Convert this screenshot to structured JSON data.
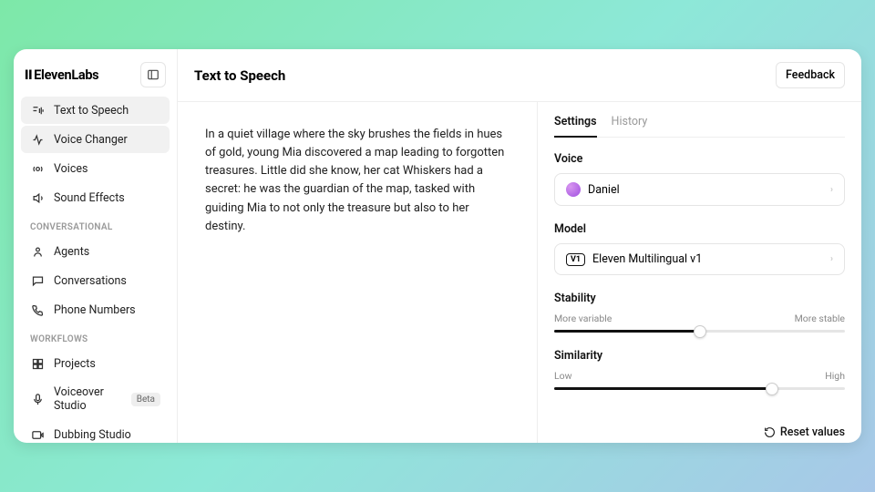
{
  "brand": "ElevenLabs",
  "sidebar": {
    "items": [
      {
        "label": "Text to Speech",
        "active": true
      },
      {
        "label": "Voice Changer",
        "active": true
      },
      {
        "label": "Voices"
      },
      {
        "label": "Sound Effects"
      }
    ],
    "conversational_label": "CONVERSATIONAL",
    "conversational": [
      {
        "label": "Agents"
      },
      {
        "label": "Conversations"
      },
      {
        "label": "Phone Numbers"
      }
    ],
    "workflows_label": "WORKFLOWS",
    "workflows": [
      {
        "label": "Projects"
      },
      {
        "label": "Voiceover Studio",
        "badge": "Beta"
      },
      {
        "label": "Dubbing Studio"
      }
    ]
  },
  "topbar": {
    "title": "Text to Speech",
    "feedback": "Feedback"
  },
  "editor": {
    "text": "In a quiet village where the sky brushes the fields in hues of gold, young Mia discovered a map leading to forgotten treasures. Little did she know, her cat Whiskers had a secret: he was the guardian of the map, tasked with guiding Mia to not only the treasure but also to her destiny."
  },
  "settings": {
    "tabs": {
      "settings": "Settings",
      "history": "History"
    },
    "voice_label": "Voice",
    "voice_value": "Daniel",
    "model_label": "Model",
    "model_badge": "V1",
    "model_value": "Eleven Multilingual v1",
    "stability": {
      "label": "Stability",
      "low": "More variable",
      "high": "More stable",
      "value_pct": 50
    },
    "similarity": {
      "label": "Similarity",
      "low": "Low",
      "high": "High",
      "value_pct": 75
    },
    "reset": "Reset values"
  }
}
